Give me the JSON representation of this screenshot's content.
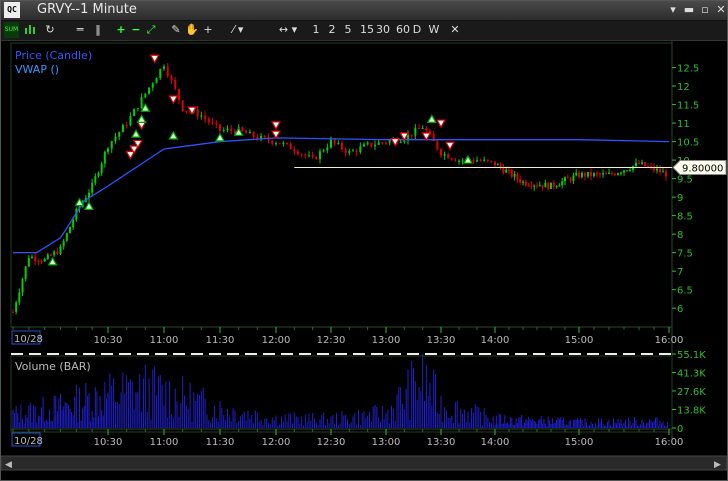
{
  "window": {
    "title": "GRVY--1 Minute",
    "app_icon_text": "QC"
  },
  "window_controls": {
    "menu": "▾",
    "minimize": "▬",
    "restore": "▫",
    "close": "✕"
  },
  "toolbar": {
    "sum_label": "SUM",
    "bar_labels": [
      "1",
      "2",
      "5",
      "15",
      "30",
      "60",
      "D",
      "W"
    ],
    "close_label": "✕"
  },
  "price_pane": {
    "legend": [
      "Price (Candle)",
      "VWAP ()"
    ],
    "line_value_label": "9.80000",
    "y_ticks": [
      "12.5",
      "12",
      "11.5",
      "11",
      "10.5",
      "10",
      "9.5",
      "9",
      "8.5",
      "8",
      "7.5",
      "7",
      "6.5",
      "6"
    ]
  },
  "volume_pane": {
    "legend": "Volume (BAR)",
    "y_ticks": [
      "55.1K",
      "41.3K",
      "27.6K",
      "13.8K",
      "0"
    ]
  },
  "time_axis": {
    "date_label": "10/28",
    "ticks": [
      "10:30",
      "11:00",
      "11:30",
      "12:00",
      "12:30",
      "13:00",
      "13:30",
      "14:00",
      "15:00",
      "16:00"
    ]
  },
  "colors": {
    "up": "#00d000",
    "down": "#e00000",
    "vwap": "#2a55ff",
    "volume": "#2020d0",
    "grid": "#1a3a1a",
    "axis_text": "#2fbf2f",
    "legend_price": "#3355ff",
    "legend_vwap": "#3399ff"
  },
  "chart_data": [
    {
      "type": "line",
      "title": "",
      "series": [
        {
          "name": "Price (Candle)",
          "x": [
            "09:30",
            "09:40",
            "09:50",
            "10:00",
            "10:10",
            "10:20",
            "10:30",
            "10:40",
            "10:50",
            "11:00",
            "11:10",
            "11:20",
            "11:30",
            "11:40",
            "11:50",
            "12:00",
            "12:10",
            "12:20",
            "12:30",
            "12:40",
            "12:50",
            "13:00",
            "13:10",
            "13:20",
            "13:30",
            "13:40",
            "13:50",
            "14:00",
            "14:20",
            "14:40",
            "15:00",
            "15:20",
            "15:40",
            "16:00"
          ],
          "values": [
            5.9,
            7.4,
            7.3,
            7.6,
            8.6,
            9.3,
            10.4,
            11.0,
            11.8,
            12.6,
            11.4,
            11.2,
            10.8,
            10.8,
            10.6,
            10.5,
            10.3,
            10.0,
            10.5,
            10.2,
            10.4,
            10.5,
            10.6,
            10.9,
            10.2,
            10.0,
            10.0,
            9.9,
            9.4,
            9.3,
            9.6,
            9.6,
            9.9,
            9.6
          ]
        },
        {
          "name": "VWAP ()",
          "x": [
            "09:30",
            "09:45",
            "10:00",
            "10:15",
            "10:30",
            "10:45",
            "11:00",
            "11:15",
            "11:30",
            "12:00",
            "13:00",
            "14:00",
            "15:00",
            "16:00"
          ],
          "values": [
            7.5,
            7.5,
            7.9,
            8.9,
            9.3,
            9.8,
            10.3,
            10.4,
            10.5,
            10.6,
            10.55,
            10.55,
            10.55,
            10.5
          ]
        }
      ],
      "ylim": [
        5.6,
        13.0
      ],
      "horizontal_line": 9.8,
      "grid": false,
      "legend_placement": "top-left"
    },
    {
      "type": "bar",
      "title": "",
      "series": [
        {
          "name": "Volume (BAR)",
          "x": [
            "09:30",
            "10:00",
            "10:30",
            "10:50",
            "11:00",
            "11:30",
            "12:00",
            "12:30",
            "13:00",
            "13:20",
            "13:30",
            "14:00",
            "15:00",
            "16:00"
          ],
          "values": [
            14000,
            22000,
            35000,
            40000,
            37000,
            20000,
            10000,
            9000,
            15000,
            52000,
            24000,
            9000,
            6000,
            7000
          ]
        }
      ],
      "ylim": [
        0,
        55100
      ],
      "grid": false
    }
  ]
}
